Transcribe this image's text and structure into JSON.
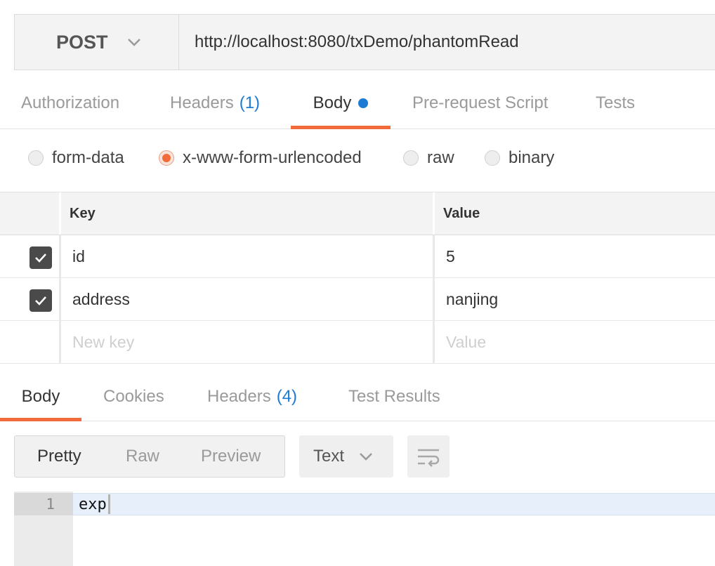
{
  "request": {
    "method": "POST",
    "url": "http://localhost:8080/txDemo/phantomRead"
  },
  "request_tabs": [
    {
      "label": "Authorization"
    },
    {
      "label": "Headers",
      "count": "(1)"
    },
    {
      "label": "Body"
    },
    {
      "label": "Pre-request Script"
    },
    {
      "label": "Tests"
    }
  ],
  "body_types": [
    {
      "label": "form-data",
      "selected": false
    },
    {
      "label": "x-www-form-urlencoded",
      "selected": true
    },
    {
      "label": "raw",
      "selected": false
    },
    {
      "label": "binary",
      "selected": false
    }
  ],
  "params": {
    "headers": {
      "key": "Key",
      "value": "Value"
    },
    "rows": [
      {
        "key": "id",
        "value": "5",
        "checked": true
      },
      {
        "key": "address",
        "value": "nanjing",
        "checked": true
      }
    ],
    "new_row": {
      "key_placeholder": "New key",
      "value_placeholder": "Value"
    }
  },
  "response_tabs": [
    {
      "label": "Body"
    },
    {
      "label": "Cookies"
    },
    {
      "label": "Headers",
      "count": "(4)"
    },
    {
      "label": "Test Results"
    }
  ],
  "view_modes": [
    {
      "label": "Pretty"
    },
    {
      "label": "Raw"
    },
    {
      "label": "Preview"
    }
  ],
  "format": {
    "label": "Text"
  },
  "editor": {
    "lines": [
      {
        "number": "1",
        "text": "exp"
      }
    ]
  },
  "colors": {
    "accent": "#f26b3a",
    "link": "#1d7bd4"
  }
}
